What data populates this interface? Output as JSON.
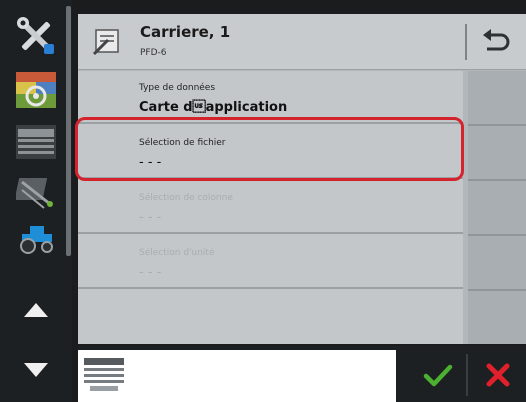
{
  "header": {
    "title": "Carriere, 1",
    "subtitle": "PFD-6"
  },
  "rows": [
    {
      "label": "Type de données",
      "value": "Carte d\u001fapplication",
      "enabled": true
    },
    {
      "label": "Sélection de fichier",
      "value": "- - -",
      "enabled": true,
      "highlighted": true
    },
    {
      "label": "Sélection de colonne",
      "value": "- - -",
      "enabled": false
    },
    {
      "label": "Sélection d'unité",
      "value": "- - -",
      "enabled": false
    }
  ],
  "icons": {
    "sidebar": [
      "tools-icon",
      "application-map-icon",
      "implement-icon",
      "sprayer-icon",
      "tractor-icon",
      "arrow-up-icon",
      "arrow-down-icon"
    ],
    "header": "file-edit-icon",
    "back": "back-arrow-icon",
    "bottom": "implement-small-icon",
    "confirm": "checkmark-icon",
    "cancel": "close-icon"
  },
  "colors": {
    "highlight": "#d4232d",
    "confirm": "#4caf2f",
    "cancel": "#e0202a"
  }
}
